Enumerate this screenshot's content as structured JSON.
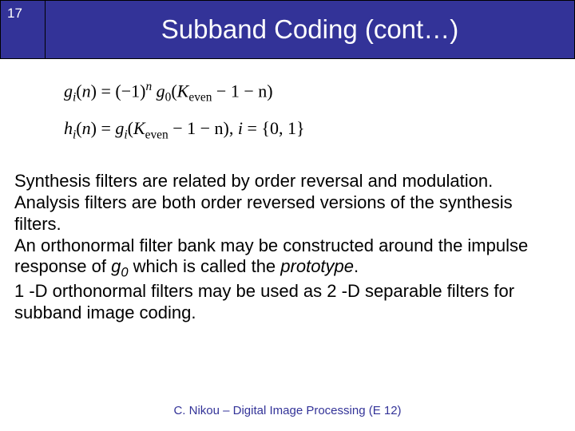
{
  "header": {
    "page_number": "17",
    "title": "Subband Coding (cont…)"
  },
  "equations": {
    "g_lhs_var": "g",
    "g_lhs_sub": "i",
    "arg_n": "n",
    "eq_sign": "=",
    "minus_one": "−1",
    "exp_n": "n",
    "g0_var": "g",
    "g0_sub": "0",
    "k_even": "K",
    "k_even_sub": "even",
    "minus1_minus_n": " − 1 − n",
    "h_lhs_var": "h",
    "h_lhs_sub": "i",
    "comma_sep": ",   ",
    "i_set_lhs": "i",
    "i_set_rhs": "{0, 1}"
  },
  "body": {
    "p1": "Synthesis filters are related by order reversal and modulation.",
    "p2": "Analysis filters are both order reversed versions of the synthesis filters.",
    "p3_a": "An orthonormal filter bank may be constructed around the impulse response of ",
    "p3_g_var": "g",
    "p3_g_sub": "0",
    "p3_b": " which is called the ",
    "p3_em": "prototype",
    "p3_c": ".",
    "p4": "1 -D orthonormal filters may be used as 2 -D separable filters for subband image coding."
  },
  "footer": {
    "credit": "C. Nikou – Digital Image Processing (E 12)"
  }
}
